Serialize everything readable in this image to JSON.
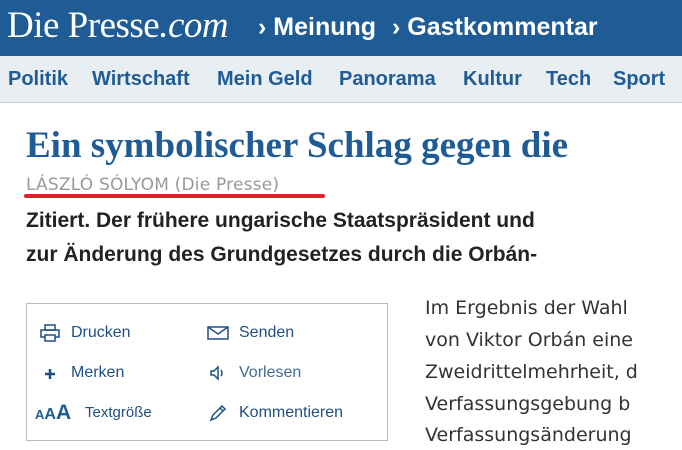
{
  "header": {
    "logo": {
      "main": "Die Presse",
      "suffix": ".com"
    },
    "breadcrumb": [
      "› Meinung",
      "› Gastkommentar"
    ]
  },
  "nav": {
    "items": [
      "Politik",
      "Wirtschaft",
      "Mein Geld",
      "Panorama",
      "Kultur",
      "Tech",
      "Sport"
    ]
  },
  "article": {
    "headline": "Ein symbolischer Schlag gegen die",
    "byline": "LÁSZLÓ SÓLYOM (Die Presse)",
    "lead": [
      "Zitiert. Der frühere ungarische Staatspräsident und",
      "zur Änderung des Grundgesetzes durch die Orbán-"
    ],
    "body_lines": [
      "Im Ergebnis der Wahl",
      "von Viktor Orbán eine",
      "Zweidrittelmehrheit, d",
      "Verfassungsgebung b",
      "Verfassungsänderung"
    ]
  },
  "toolbox": {
    "print": "Drucken",
    "send": "Senden",
    "bookmark": "Merken",
    "read_aloud": "Vorlesen",
    "font_size_letters": {
      "a": "A",
      "b": "A",
      "c": "A"
    },
    "font_size": "Textgröße",
    "comment": "Kommentieren"
  },
  "colors": {
    "brand_blue": "#1f5c96",
    "nav_background": "#e9eef3",
    "byline_gray": "#999999",
    "highlight_red": "#e2202a"
  }
}
